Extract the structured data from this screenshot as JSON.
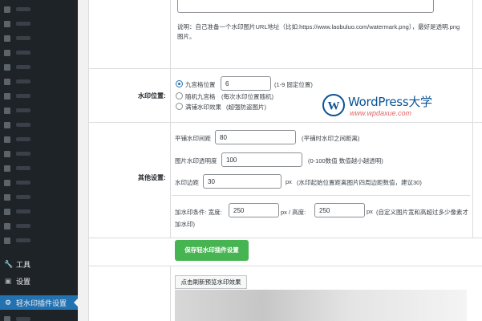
{
  "sidebar": {
    "tools_label": "工具",
    "settings_label": "设置",
    "active_label": "轻水印插件设置",
    "tools_icon": "wrench-icon",
    "settings_icon": "settings-icon",
    "active_icon": "plugin-icon"
  },
  "watermark_url": {
    "value": "",
    "description": "说明：自己准备一个水印图片URL地址（比如:https://www.laobuluo.com/watermark.png），最好是透明.png 图片。"
  },
  "position": {
    "label": "水印位置:",
    "options": [
      {
        "label": "九宫格位置",
        "checked": true
      },
      {
        "label": "随机九宫格",
        "checked": false
      },
      {
        "label": "满铺水印效果",
        "checked": false
      }
    ],
    "grid_value": "6",
    "grid_hint": "(1-9 固定位置)",
    "random_hint": "(每次水印位置随机)",
    "tile_hint": "(超强防盗图片)"
  },
  "watermark_logo": {
    "brand": "WordPress大学",
    "url": "www.wpdaxue.com"
  },
  "other": {
    "label": "其他设置:",
    "tile_spacing_label": "平铺水印间距",
    "tile_spacing_value": "80",
    "tile_spacing_hint": "(平铺时水印之间距离)",
    "opacity_label": "图片水印透明度",
    "opacity_value": "100",
    "opacity_hint": "(0-100数值 数值越小越透明)",
    "margin_label": "水印边距",
    "margin_value": "30",
    "margin_unit": "px",
    "margin_hint": "(水印起始位置距离图片四周边距数值，建议30)",
    "condition_label": "加水印条件: 宽度:",
    "width_value": "250",
    "height_label": "px / 高度:",
    "height_value": "250",
    "condition_unit": "px",
    "condition_hint": "(自定义图片宽和高超过多少像素才",
    "condition_hint_2": "加水印)"
  },
  "actions": {
    "save_label": "保存轻水印插件设置",
    "preview_label": "点击刷新预览水印效果"
  },
  "colors": {
    "sidebar_bg": "#1d2327",
    "active_bg": "#2271b1",
    "save_button": "#46b450"
  }
}
